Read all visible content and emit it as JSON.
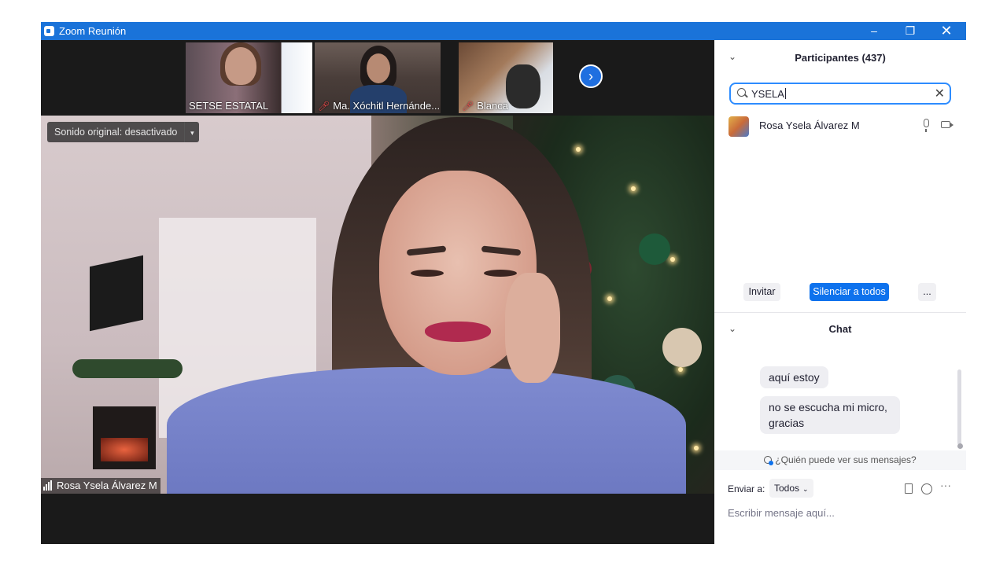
{
  "window": {
    "title": "Zoom Reunión",
    "min": "–",
    "max": "❐",
    "close": "✕"
  },
  "strip": {
    "thumbnails": [
      {
        "name": "SETSE ESTATAL",
        "muted": false
      },
      {
        "name": "Ma. Xóchitl Hernánde...",
        "muted": true
      },
      {
        "name": "Blanca",
        "muted": true
      }
    ],
    "next": "›"
  },
  "main_video": {
    "audio_label": "Sonido original: desactivado",
    "caret": "▾",
    "speaker": "Rosa Ysela Álvarez M"
  },
  "participants": {
    "title": "Participantes (437)",
    "chevron": "⌄",
    "search_value": "YSELA",
    "clear": "✕",
    "list": [
      {
        "name": "Rosa Ysela Álvarez M"
      }
    ],
    "invite": "Invitar",
    "mute_all": "Silenciar a todos",
    "more": "..."
  },
  "chat": {
    "title": "Chat",
    "chevron": "⌄",
    "messages": [
      "aquí estoy",
      "no se escucha mi micro, gracias"
    ],
    "who_can_see": "¿Quién puede ver sus mensajes?",
    "send_to_label": "Enviar a:",
    "send_to_value": "Todos",
    "arrow": "⌄",
    "more": "···",
    "placeholder": "Escribir mensaje aquí..."
  },
  "colors": {
    "titlebar": "#1a73d9",
    "accent": "#0e72ed",
    "focus": "#2d8cff"
  }
}
